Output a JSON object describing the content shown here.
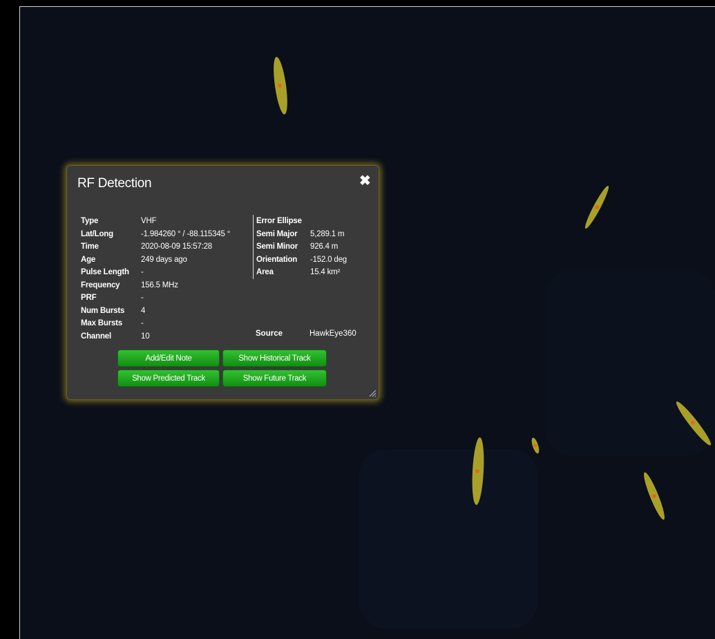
{
  "popup": {
    "title": "RF Detection",
    "close_glyph": "✖",
    "left_fields": [
      {
        "label": "Type",
        "value": "VHF"
      },
      {
        "label": "Lat/Long",
        "value": "-1.984260 ° / -88.115345 °"
      },
      {
        "label": "Time",
        "value": "2020-08-09 15:57:28"
      },
      {
        "label": "Age",
        "value": "249 days ago"
      },
      {
        "label": "Pulse Length",
        "value": "-"
      },
      {
        "label": "Frequency",
        "value": "156.5 MHz"
      },
      {
        "label": "PRF",
        "value": "-"
      },
      {
        "label": "Num Bursts",
        "value": "4"
      },
      {
        "label": "Max Bursts",
        "value": "-"
      },
      {
        "label": "Channel",
        "value": "10"
      }
    ],
    "right_fields": [
      {
        "label": "Error Ellipse",
        "value": ""
      },
      {
        "label": "Semi Major",
        "value": "5,289.1 m"
      },
      {
        "label": "Semi Minor",
        "value": "926.4 m"
      },
      {
        "label": "Orientation",
        "value": "-152.0 deg"
      },
      {
        "label": "Area",
        "value": "15.4 km²"
      }
    ],
    "source": {
      "label": "Source",
      "value": "HawkEye360"
    },
    "buttons": {
      "add_note": "Add/Edit Note",
      "historical": "Show Historical Track",
      "predicted": "Show Predicted Track",
      "future": "Show Future Track"
    }
  },
  "colors": {
    "ellipse_fill": "#a9a02a",
    "ellipse_center": "#e06a1a",
    "popup_glow": "#c4aa28",
    "button_green": "#22a822"
  }
}
